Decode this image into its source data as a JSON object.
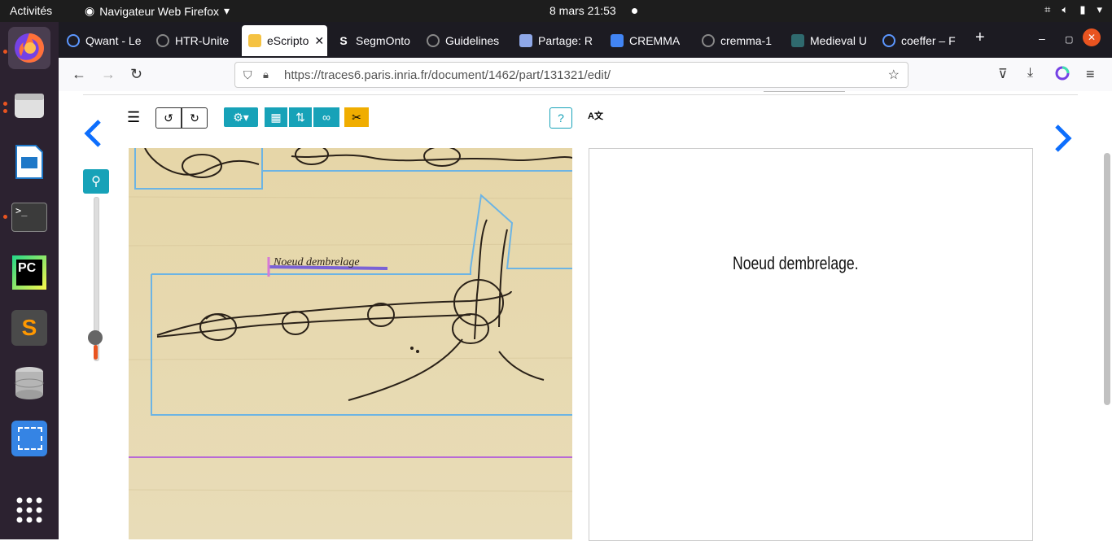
{
  "topbar": {
    "activities": "Activités",
    "app_menu": "Navigateur Web Firefox",
    "clock": "8 mars  21:53"
  },
  "dock": {
    "items": [
      "firefox-icon",
      "files-icon",
      "writer-icon",
      "terminal-icon",
      "pycharm-icon",
      "sublime-icon",
      "database-icon",
      "screenshot-icon",
      "apps-grid-icon"
    ]
  },
  "tabs": [
    {
      "label": "Qwant - Le"
    },
    {
      "label": "HTR-Unite"
    },
    {
      "label": "eScripto"
    },
    {
      "label": "SegmOnto"
    },
    {
      "label": "Guidelines"
    },
    {
      "label": "Partage: R"
    },
    {
      "label": "CREMMA"
    },
    {
      "label": "cremma-1"
    },
    {
      "label": "Medieval U"
    },
    {
      "label": "coeffer – F"
    }
  ],
  "navbar": {
    "url": "https://traces6.paris.inria.fr/document/1462/part/131321/edit/"
  },
  "editor": {
    "help_label": "?",
    "transcription_line": "Noeud dembrelage.",
    "image_line_text": "Noeud dembrelage"
  },
  "colors": {
    "teal": "#17a2b8",
    "yellow": "#f0ad00",
    "nav_blue": "#0d6efd",
    "region_blue": "#6cb4e4",
    "line_purple": "#7a62d6"
  },
  "zoom": {
    "level_fraction": 0.1
  }
}
